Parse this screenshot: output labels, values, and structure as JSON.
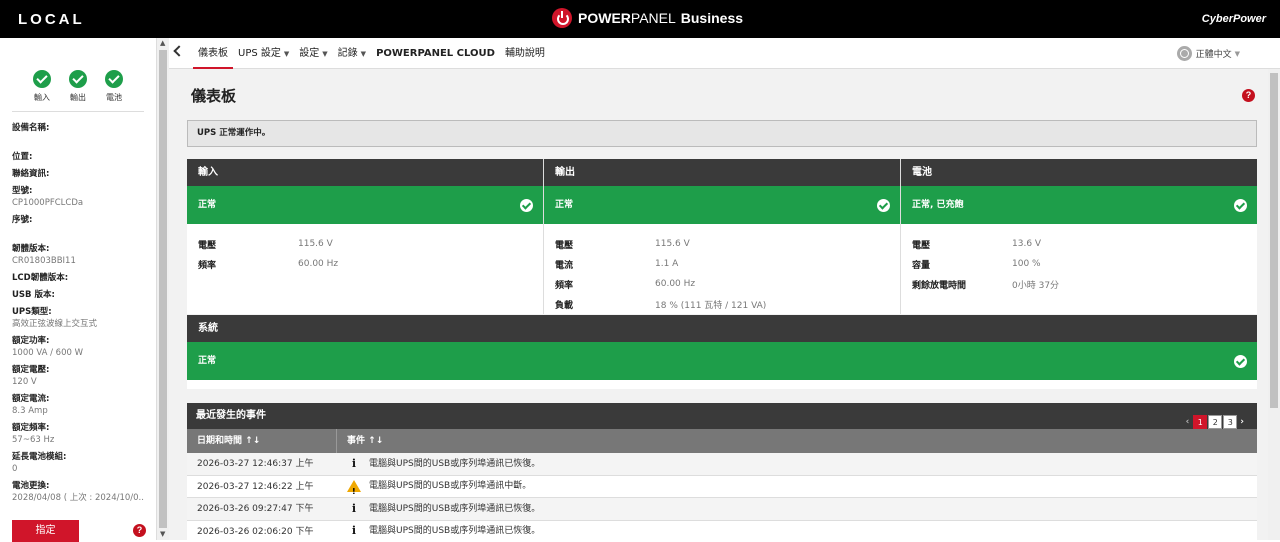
{
  "topbar": {
    "location": "LOCAL",
    "brand_power": "POWER",
    "brand_panel": "PANEL",
    "brand_business": "Business",
    "vendor": "CyberPower"
  },
  "sidebar": {
    "status": [
      {
        "label": "輸入",
        "icon": "check-circle-icon"
      },
      {
        "label": "輸出",
        "icon": "check-circle-icon"
      },
      {
        "label": "電池",
        "icon": "check-circle-icon"
      }
    ],
    "props": [
      {
        "k": "設備名稱:",
        "v": ""
      },
      {
        "k": "位置:",
        "v": ""
      },
      {
        "k": "聯絡資訊:",
        "v": ""
      },
      {
        "k": "型號:",
        "v": "CP1000PFCLCDa"
      },
      {
        "k": "序號:",
        "v": ""
      },
      {
        "k": "韌體版本:",
        "v": "CR01803BBI11"
      },
      {
        "k": "LCD韌體版本:",
        "v": ""
      },
      {
        "k": "USB 版本:",
        "v": ""
      },
      {
        "k": "UPS類型:",
        "v": "高效正弦波線上交互式"
      },
      {
        "k": "額定功率:",
        "v": "1000 VA / 600 W"
      },
      {
        "k": "額定電壓:",
        "v": "120 V"
      },
      {
        "k": "額定電流:",
        "v": "8.3 Amp"
      },
      {
        "k": "額定頻率:",
        "v": "57~63 Hz"
      },
      {
        "k": "延長電池模組:",
        "v": "0"
      },
      {
        "k": "電池更換:",
        "v": "2028/04/08 ( 上次 : 2024/10/0..."
      }
    ],
    "assign_label": "指定"
  },
  "nav": {
    "items": [
      {
        "label": "儀表板",
        "dropdown": false,
        "active": true
      },
      {
        "label": "UPS 設定",
        "dropdown": true
      },
      {
        "label": "設定",
        "dropdown": true
      },
      {
        "label": "記錄",
        "dropdown": true
      },
      {
        "label": "POWERPANEL CLOUD",
        "dropdown": false
      },
      {
        "label": "輔助說明",
        "dropdown": false
      }
    ],
    "language": "正體中文"
  },
  "main": {
    "title": "儀表板",
    "status_message": "UPS 正常運作中。",
    "panels": [
      {
        "title": "輸入",
        "status": "正常",
        "rows": [
          {
            "k": "電壓",
            "v": "115.6 V"
          },
          {
            "k": "頻率",
            "v": "60.00 Hz"
          }
        ]
      },
      {
        "title": "輸出",
        "status": "正常",
        "rows": [
          {
            "k": "電壓",
            "v": "115.6 V"
          },
          {
            "k": "電流",
            "v": "1.1 A"
          },
          {
            "k": "頻率",
            "v": "60.00 Hz"
          },
          {
            "k": "負載",
            "v": "18 % (111 瓦特 / 121 VA)"
          }
        ]
      },
      {
        "title": "電池",
        "status": "正常, 已充飽",
        "rows": [
          {
            "k": "電壓",
            "v": "13.6 V"
          },
          {
            "k": "容量",
            "v": "100 %"
          },
          {
            "k": "剩餘放電時間",
            "v": "0小時 37分"
          }
        ]
      }
    ],
    "system": {
      "title": "系統",
      "status": "正常"
    },
    "events": {
      "title": "最近發生的事件",
      "pages": [
        "1",
        "2",
        "3"
      ],
      "current_page": "1",
      "col_time": "日期和時間",
      "col_event": "事件",
      "rows": [
        {
          "time": "2026-03-27 12:46:37 上午",
          "icon": "info",
          "text": "電腦與UPS間的USB或序列埠通訊已恢復。"
        },
        {
          "time": "2026-03-27 12:46:22 上午",
          "icon": "warning",
          "text": "電腦與UPS間的USB或序列埠通訊中斷。"
        },
        {
          "time": "2026-03-26 09:27:47 下午",
          "icon": "info",
          "text": "電腦與UPS間的USB或序列埠通訊已恢復。"
        },
        {
          "time": "2026-03-26 02:06:20 下午",
          "icon": "info",
          "text": "電腦與UPS間的USB或序列埠通訊已恢復。"
        }
      ]
    }
  },
  "colors": {
    "accent": "#d0152a",
    "ok": "#1e9e4a",
    "header": "#3a3a3a"
  }
}
